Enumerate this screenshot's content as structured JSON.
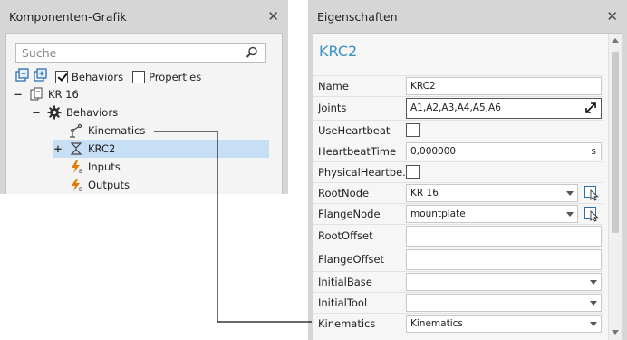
{
  "left_panel": {
    "title": "Komponenten-Grafik",
    "search_placeholder": "Suche",
    "toolbar": {
      "behaviors_label": "Behaviors",
      "behaviors_checked": true,
      "properties_label": "Properties",
      "properties_checked": false
    },
    "tree": [
      {
        "label": "KR 16",
        "expander": "−",
        "icon": "component-icon"
      },
      {
        "label": "Behaviors",
        "expander": "−",
        "icon": "gear-icon"
      },
      {
        "label": "Kinematics",
        "expander": "",
        "icon": "kinematics-icon"
      },
      {
        "label": "KRC2",
        "expander": "+",
        "icon": "robot-controller-icon",
        "selected": true
      },
      {
        "label": "Inputs",
        "expander": "",
        "icon": "signal-icon"
      },
      {
        "label": "Outputs",
        "expander": "",
        "icon": "signal-icon"
      }
    ]
  },
  "right_panel": {
    "title": "Eigenschaften",
    "component_name": "KRC2",
    "properties": [
      {
        "name": "Name",
        "value": "KRC2"
      },
      {
        "name": "Joints",
        "value": "A1,A2,A3,A4,A5,A6"
      },
      {
        "name": "UseHeartbeat",
        "value": ""
      },
      {
        "name": "HeartbeatTime",
        "value": "0,000000",
        "unit": "s"
      },
      {
        "name": "PhysicalHeartbe...",
        "value": ""
      },
      {
        "name": "RootNode",
        "value": "KR 16"
      },
      {
        "name": "FlangeNode",
        "value": "mountplate"
      },
      {
        "name": "RootOffset",
        "value": ""
      },
      {
        "name": "FlangeOffset",
        "value": ""
      },
      {
        "name": "InitialBase",
        "value": ""
      },
      {
        "name": "InitialTool",
        "value": ""
      },
      {
        "name": "Kinematics",
        "value": "Kinematics"
      }
    ]
  },
  "colors": {
    "panel_bg": "#d6d6d6",
    "accent_title": "#3b8fc4",
    "selection": "#c7dff5"
  }
}
